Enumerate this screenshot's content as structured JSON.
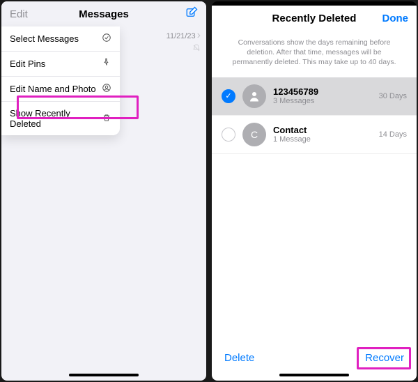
{
  "left": {
    "edit": "Edit",
    "title": "Messages",
    "date": "11/21/23",
    "menu": {
      "select": "Select Messages",
      "editPins": "Edit Pins",
      "editNamePhoto": "Edit Name and Photo",
      "showDeleted": "Show Recently Deleted"
    }
  },
  "right": {
    "title": "Recently Deleted",
    "done": "Done",
    "info": "Conversations show the days remaining before deletion. After that time, messages will be permanently deleted. This may take up to 40 days.",
    "conversations": [
      {
        "name": "123456789",
        "sub": "3 Messages",
        "days": "30 Days",
        "avatarLetter": "",
        "selected": true
      },
      {
        "name": "Contact",
        "sub": "1 Message",
        "days": "14 Days",
        "avatarLetter": "C",
        "selected": false
      }
    ],
    "delete": "Delete",
    "recover": "Recover"
  }
}
